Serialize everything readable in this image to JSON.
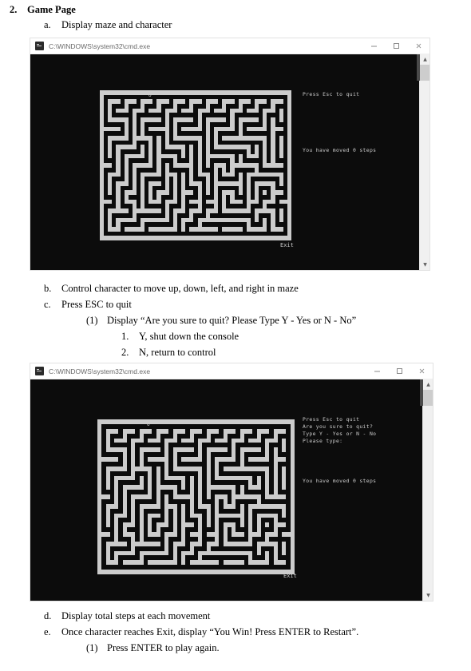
{
  "document": {
    "items": [
      {
        "level": 1,
        "marker": "2.",
        "text": "Game Page"
      },
      {
        "level": 2,
        "marker": "a.",
        "text": "Display maze and character"
      },
      {
        "level": 2,
        "marker": "b.",
        "text": "Control character to move up, down, left, and right in maze"
      },
      {
        "level": 2,
        "marker": "c.",
        "text": "Press ESC to quit"
      },
      {
        "level": 3,
        "marker": "(1)",
        "text": "Display “Are you sure to quit? Please Type Y - Yes or N - No”"
      },
      {
        "level": 4,
        "marker": "1.",
        "text": "Y, shut down the console"
      },
      {
        "level": 4,
        "marker": "2.",
        "text": "N, return to control"
      },
      {
        "level": 2,
        "marker": "d.",
        "text": "Display total steps at each movement"
      },
      {
        "level": 2,
        "marker": "e.",
        "text": "Once character reaches Exit, display “You Win! Press ENTER to Restart”."
      },
      {
        "level": 3,
        "marker": "(1)",
        "text": "Press ENTER to play again."
      }
    ]
  },
  "console_windows": [
    {
      "title": "C:\\WINDOWS\\system32\\cmd.exe",
      "minimize_label": "—",
      "maximize_label": "□",
      "close_label": "✕",
      "console_lines": [
        "Press Esc to quit"
      ],
      "steps_line": "You have moved 0 steps",
      "player_char": "O",
      "exit_label": "Exit"
    },
    {
      "title": "C:\\WINDOWS\\system32\\cmd.exe",
      "minimize_label": "—",
      "maximize_label": "□",
      "close_label": "✕",
      "console_lines": [
        "Press Esc to quit",
        "Are you sure to quit?",
        "Type Y - Yes or N - No",
        "Please type:"
      ],
      "steps_line": "You have moved 0 steps",
      "player_char": "O",
      "exit_label": "Exit"
    }
  ],
  "colors": {
    "console_background": "#0c0c0c",
    "maze_wall": "#cccccc",
    "console_text": "#cccccc",
    "window_chrome": "#ffffff",
    "scrollbar_track": "#f0f0f0",
    "scrollbar_thumb": "#cdcdcd"
  },
  "maze": {
    "cols": 47,
    "rows": 33,
    "legend": {
      "1": "wall",
      "0": "open"
    },
    "grid": [
      "11111111111111111111111111111111111111111111111",
      "10000000000000000000000000000000000000000000001",
      "10111011101110111011101110111011101110111011101",
      "10100010001000100010001000100010001000100010001",
      "10101110111011101110111011101110111011101110101",
      "10100000100000001000000010000000100000001000101",
      "10111110101111101011111010111110101111101010101",
      "10000010101000001010000010100000101000001010001",
      "11111010101011111010111110101111101011111011101",
      "10000010101000001010000000101000001000000010001",
      "10111110111110101011111110101011111111111010101",
      "10100000100010101000000010101000000000001010101",
      "10101111101010101111101010101111111110101010101",
      "10101000001010100000101010100000000010101010101",
      "10101011111010111110101010111111101011101010101",
      "10001010000010100010001010100000101000001010001",
      "11101010111110101011111010101110111111101111101",
      "10001010100000101000001010001010100000100000001",
      "10111010101111101110101011101011101011111111101",
      "10100010101000001010101000101000001010000000101",
      "10101110101011101010101110101111111010111110101",
      "10101000101010001010100010101000001010100010001",
      "10101011101010111010111010101011101010101011101",
      "10001010001010100010100010001010100010100010001",
      "11101011101011101110101110111010111011101110111",
      "10001000101000001000100010001010000010001000001",
      "10111110111111101011101110111011111110111110101",
      "10100000100000001010001000100000000000100010101",
      "10101111101111111010111011111111111110101010101",
      "10101000001000000010100010000000000010001010001",
      "10111011111011111110101111111011111011111011101",
      "10000000000000000000000000000000000000000000001",
      "11111111111111111111111111111111111111111111111"
    ],
    "player_cell": {
      "col": 2,
      "row": 1
    },
    "exit_cell": {
      "col": 41,
      "row": 32
    }
  }
}
